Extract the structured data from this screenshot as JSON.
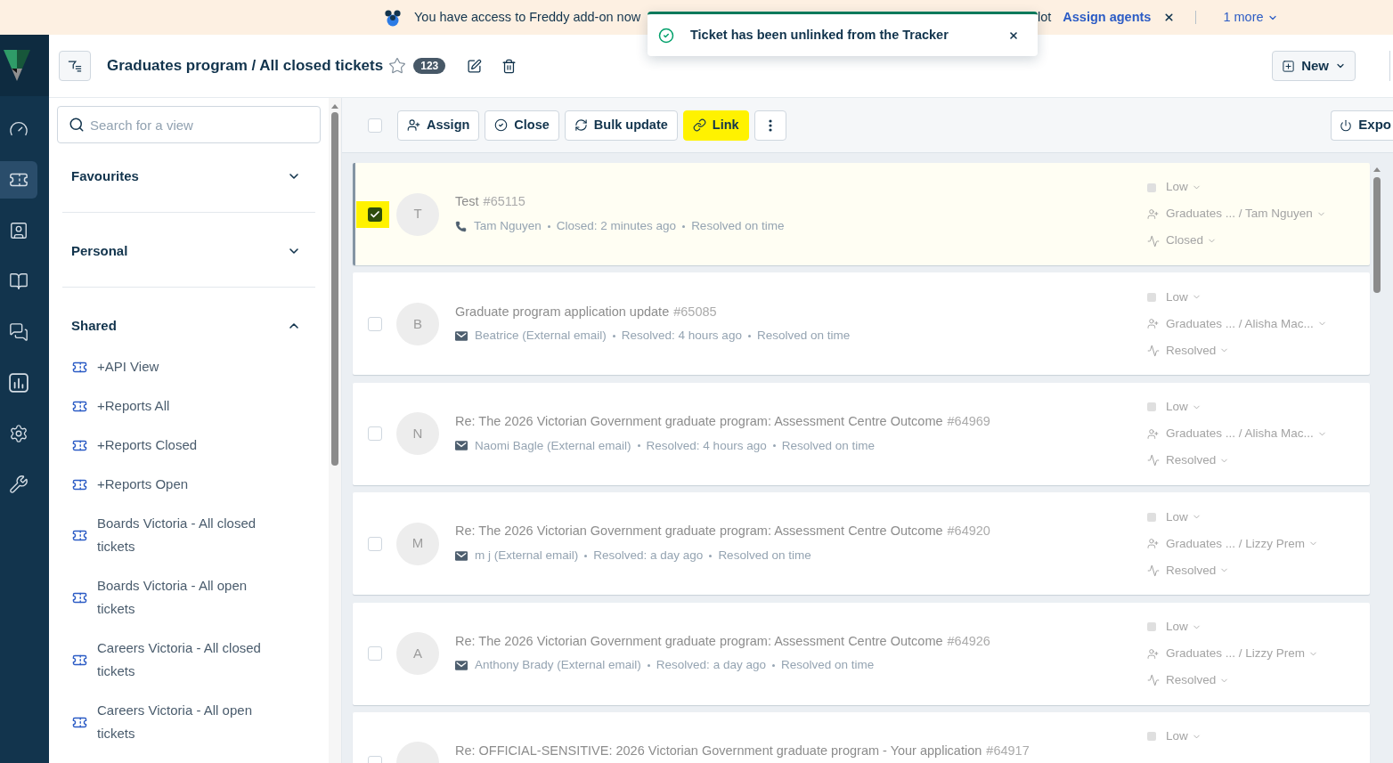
{
  "banner": {
    "message_start": "You have access to Freddy add-on now",
    "message_end": "lot",
    "link": "Assign agents",
    "more": "1 more"
  },
  "toast": {
    "message": "Ticket has been unlinked from the Tracker"
  },
  "nav": {
    "items": [
      {
        "kind": "dashboard",
        "selected": false
      },
      {
        "kind": "tickets",
        "selected": true
      },
      {
        "kind": "contacts",
        "selected": false
      },
      {
        "kind": "knowledge",
        "selected": false
      },
      {
        "kind": "conversations",
        "selected": false
      },
      {
        "kind": "reports",
        "selected": false
      },
      {
        "kind": "settings",
        "selected": false
      },
      {
        "kind": "tools",
        "selected": false
      }
    ]
  },
  "header": {
    "title": "Graduates program / All closed tickets",
    "favourite": false,
    "count": "123",
    "new_button": "New"
  },
  "sidebar": {
    "search": {
      "placeholder": "Search for a view"
    },
    "sections": [
      {
        "title": "Favourites",
        "expanded": false
      },
      {
        "title": "Personal",
        "expanded": false
      },
      {
        "title": "Shared",
        "expanded": true,
        "items": [
          "+API View",
          "+Reports All",
          "+Reports Closed",
          "+Reports Open",
          "Boards Victoria - All closed tickets",
          "Boards Victoria - All open tickets",
          "Careers Victoria - All closed tickets",
          "Careers Victoria - All open tickets"
        ]
      }
    ]
  },
  "toolbar": {
    "select_all": {
      "checked": false
    },
    "buttons": [
      {
        "kind": "assign",
        "label": "Assign",
        "highlighted": false
      },
      {
        "kind": "close",
        "label": "Close",
        "highlighted": false
      },
      {
        "kind": "bulk_update",
        "label": "Bulk update",
        "highlighted": false
      },
      {
        "kind": "link",
        "label": "Link",
        "highlighted": true
      },
      {
        "kind": "more",
        "highlighted": false
      }
    ],
    "export_button": "Expo"
  },
  "tickets": [
    {
      "kind": "phone",
      "avatar": "T",
      "subject": "Test",
      "number": "#65115",
      "requester": "Tam Nguyen",
      "activity": "Closed: 2 minutes ago",
      "sla": "Resolved on time",
      "priority": "Low",
      "assignee": "Graduates ... / Tam Nguyen",
      "status": "Closed",
      "selected": true,
      "highlighted": true
    },
    {
      "kind": "email",
      "avatar": "B",
      "subject": "Graduate program application update",
      "number": "#65085",
      "requester": "Beatrice (External email)",
      "activity": "Resolved: 4 hours ago",
      "sla": "Resolved on time",
      "priority": "Low",
      "assignee": "Graduates ... / Alisha Mac...",
      "status": "Resolved",
      "selected": false,
      "highlighted": false
    },
    {
      "kind": "email",
      "avatar": "N",
      "subject": "Re: The 2026 Victorian Government graduate program: Assessment Centre Outcome",
      "number": "#64969",
      "requester": "Naomi Bagle (External email)",
      "activity": "Resolved: 4 hours ago",
      "sla": "Resolved on time",
      "priority": "Low",
      "assignee": "Graduates ... / Alisha Mac...",
      "status": "Resolved",
      "selected": false,
      "highlighted": false
    },
    {
      "kind": "email",
      "avatar": "M",
      "subject": "Re: The 2026 Victorian Government graduate program: Assessment Centre Outcome",
      "number": "#64920",
      "requester": "m j (External email)",
      "activity": "Resolved: a day ago",
      "sla": "Resolved on time",
      "priority": "Low",
      "assignee": "Graduates ... / Lizzy Prem",
      "status": "Resolved",
      "selected": false,
      "highlighted": false
    },
    {
      "kind": "email",
      "avatar": "A",
      "subject": "Re: The 2026 Victorian Government graduate program: Assessment Centre Outcome",
      "number": "#64926",
      "requester": "Anthony Brady (External email)",
      "activity": "Resolved: a day ago",
      "sla": "Resolved on time",
      "priority": "Low",
      "assignee": "Graduates ... / Lizzy Prem",
      "status": "Resolved",
      "selected": false,
      "highlighted": false
    },
    {
      "subject": "Re: OFFICIAL-SENSITIVE: 2026 Victorian Government graduate program - Your application",
      "number": "#64917",
      "priority": "Low",
      "selected": false,
      "highlighted": false
    }
  ]
}
